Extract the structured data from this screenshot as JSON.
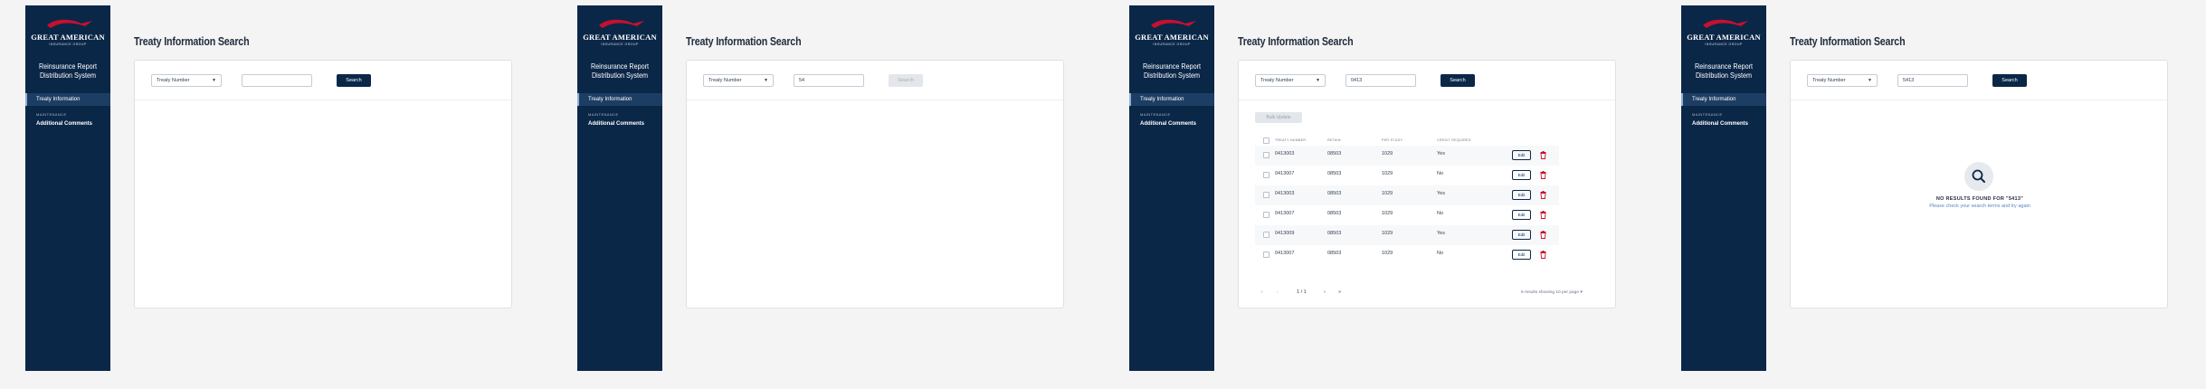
{
  "brand": {
    "logo_text": "GREAT AMERICAN",
    "logo_sub": "INSURANCE GROUP",
    "app_title_line1": "Reinsurance Report",
    "app_title_line2": "Distribution System",
    "colors": {
      "navy": "#0b2748",
      "accent_red": "#c8102e"
    }
  },
  "nav": {
    "active": "Treaty Information",
    "section": "MAINTENANCE",
    "item": "Additional Comments"
  },
  "page_title": "Treaty Information Search",
  "select_value": "Treaty Number",
  "search_label": "Search",
  "screens": [
    {
      "input_value": "",
      "search_disabled": false
    },
    {
      "input_value": "54",
      "search_disabled": true
    },
    {
      "input_value": "0413",
      "search_disabled": false
    },
    {
      "input_value": "5413",
      "search_disabled": false
    }
  ],
  "table": {
    "bulk_label": "Bulk Update",
    "headers": [
      "TREATY NUMBER",
      "RETAIN",
      "PER STUDY",
      "CREDIT REQUIRED"
    ],
    "edit_label": "Edit",
    "rows": [
      [
        "0413003",
        "08503",
        "1029",
        "Yes"
      ],
      [
        "0413007",
        "08503",
        "1029",
        "No"
      ],
      [
        "0413003",
        "08503",
        "1029",
        "Yes"
      ],
      [
        "0413007",
        "08503",
        "1029",
        "No"
      ],
      [
        "0413009",
        "08503",
        "1029",
        "Yes"
      ],
      [
        "0413007",
        "08503",
        "1029",
        "No"
      ]
    ],
    "pager": {
      "first": "«",
      "prev": "‹",
      "page": "1 / 1",
      "next": "›",
      "last": "»"
    },
    "results_info": "6 results showing   10 per page  ▾"
  },
  "empty": {
    "title": "NO RESULTS FOUND FOR \"5413\"",
    "subtitle": "Please check your search terms and try again"
  }
}
